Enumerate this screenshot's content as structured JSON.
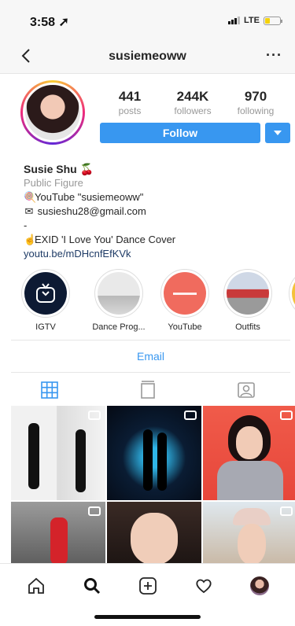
{
  "status": {
    "time": "3:58",
    "network": "LTE",
    "battery_level": 0.35
  },
  "nav": {
    "title": "susiemeoww",
    "more": "···"
  },
  "profile": {
    "stats": [
      {
        "value": "441",
        "label": "posts"
      },
      {
        "value": "244K",
        "label": "followers"
      },
      {
        "value": "970",
        "label": "following"
      }
    ],
    "follow_label": "Follow"
  },
  "bio": {
    "name": "Susie Shu 🍒",
    "category": "Public Figure",
    "line1": "YouTube \"susiemeoww\"",
    "line2": "susieshu28@gmail.com",
    "line3": "-",
    "line4": "EXID 'I Love You' Dance Cover",
    "link": "youtu.be/mDHcnfEfKVk"
  },
  "highlights": [
    {
      "label": "IGTV"
    },
    {
      "label": "Dance Prog..."
    },
    {
      "label": "YouTube"
    },
    {
      "label": "Outfits"
    }
  ],
  "email_label": "Email",
  "tabs": [
    {
      "icon": "grid-icon",
      "active": true
    },
    {
      "icon": "igtv-feed-icon",
      "active": false
    },
    {
      "icon": "tagged-icon",
      "active": false
    }
  ],
  "bottom_nav": [
    "home-icon",
    "search-icon",
    "add-icon",
    "heart-icon",
    "profile-avatar"
  ]
}
